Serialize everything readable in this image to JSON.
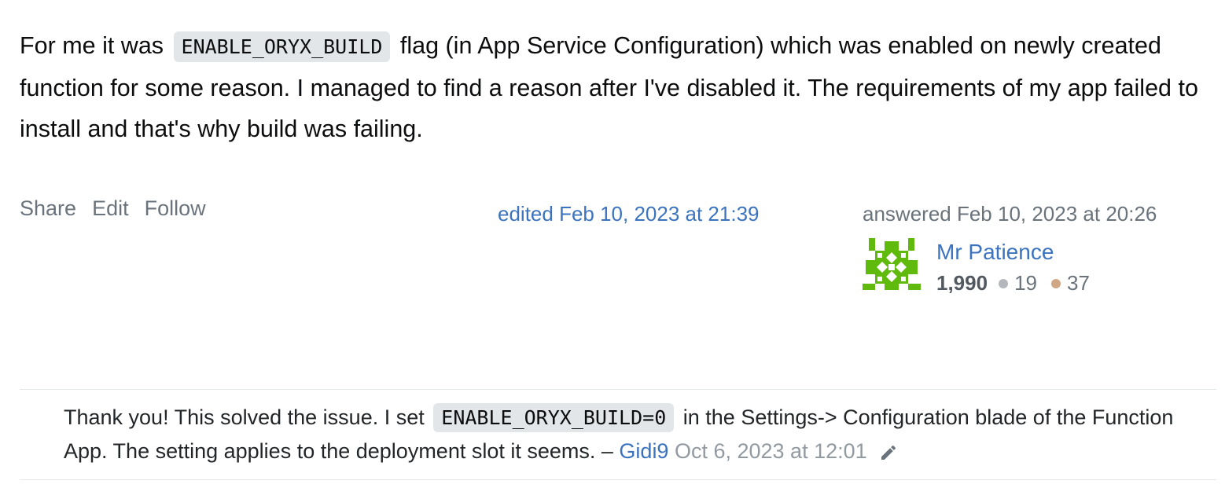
{
  "answer": {
    "text_1": "For me it was",
    "code_1": "ENABLE_ORYX_BUILD",
    "text_2": "flag (in App Service Configuration) which was enabled on newly created function for some reason. I managed to find a reason after I've disabled it. The requirements of my app failed to install and that's why build was failing."
  },
  "post_menu": {
    "share": "Share",
    "edit": "Edit",
    "follow": "Follow"
  },
  "edited": "edited Feb 10, 2023 at 21:39",
  "answered": "answered Feb 10, 2023 at 20:26",
  "user": {
    "name": "Mr Patience",
    "reputation": "1,990",
    "silver_badges": "19",
    "bronze_badges": "37",
    "avatar_color": "#5fba0d"
  },
  "comment": {
    "text_1": "Thank you! This solved the issue. I set",
    "code_1": "ENABLE_ORYX_BUILD=0",
    "text_2": "in the Settings-> Configuration blade of the Function App. The setting applies to the deployment slot it seems. –",
    "user": "Gidi9",
    "date": "Oct 6, 2023 at 12:01",
    "edit_icon": "pencil-icon"
  },
  "colors": {
    "link": "#3b73bf",
    "muted": "#6a737c",
    "code_bg": "#e3e6e8",
    "silver": "#b4b8bc",
    "bronze": "#d1a684"
  }
}
